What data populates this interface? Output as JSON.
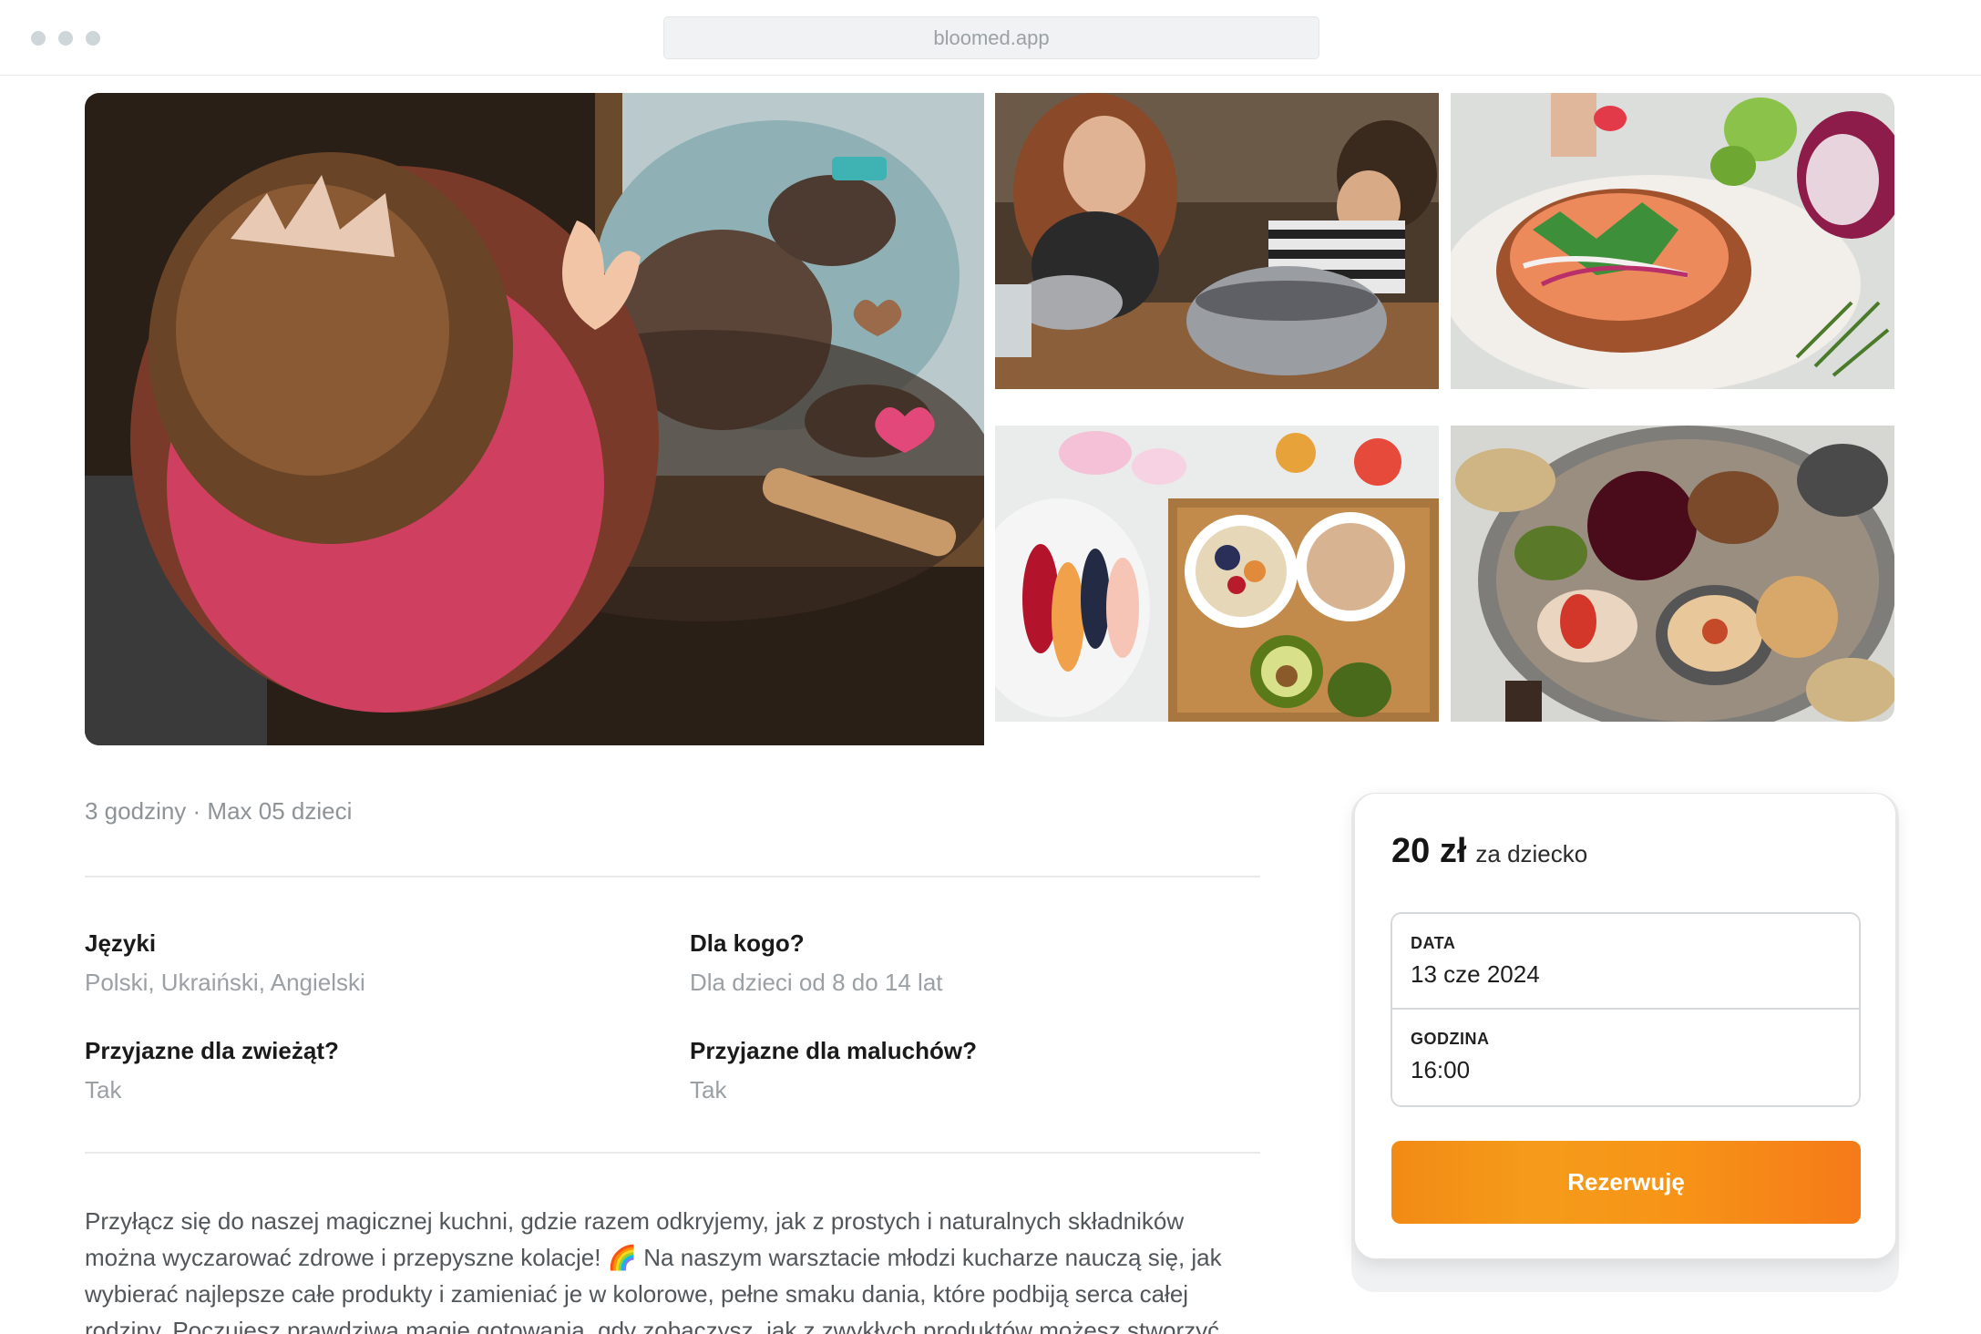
{
  "browser": {
    "url": "bloomed.app"
  },
  "gallery": {
    "images": [
      {
        "name": "photo-child-baking-cookies"
      },
      {
        "name": "photo-kids-mixing-bowls"
      },
      {
        "name": "photo-salmon-toast"
      },
      {
        "name": "photo-breakfast-table"
      },
      {
        "name": "photo-snack-platter"
      }
    ]
  },
  "workshop": {
    "meta": "3 godziny · Max 05 dzieci",
    "features": [
      {
        "title": "Języki",
        "value": "Polski, Ukraiński, Angielski"
      },
      {
        "title": "Dla kogo?",
        "value": "Dla dzieci od 8 do 14 lat"
      },
      {
        "title": "Przyjazne dla zwieżąt?",
        "value": "Tak"
      },
      {
        "title": "Przyjazne dla maluchów?",
        "value": "Tak"
      }
    ],
    "description": "Przyłącz się do naszej magicznej kuchni, gdzie razem odkryjemy, jak z prostych i naturalnych składników można wyczarować zdrowe i przepyszne kolacje! 🌈 Na naszym warsztacie młodzi kucharze nauczą się, jak wybierać najlepsze całe produkty i zamieniać je w kolorowe, pełne smaku dania, które podbiją serca całej rodziny. Poczujesz prawdziwą magię gotowania, gdy zobaczysz, jak z zwykłych produktów możesz stworzyć"
  },
  "booking": {
    "price": "20 zł",
    "price_unit": "za dziecko",
    "date_label": "DATA",
    "date_value": "13 cze 2024",
    "time_label": "GODZINA",
    "time_value": "16:00",
    "button_label": "Rezerwuję"
  },
  "colors": {
    "accent": "#f58c17",
    "muted_text": "#9aa0a4"
  }
}
